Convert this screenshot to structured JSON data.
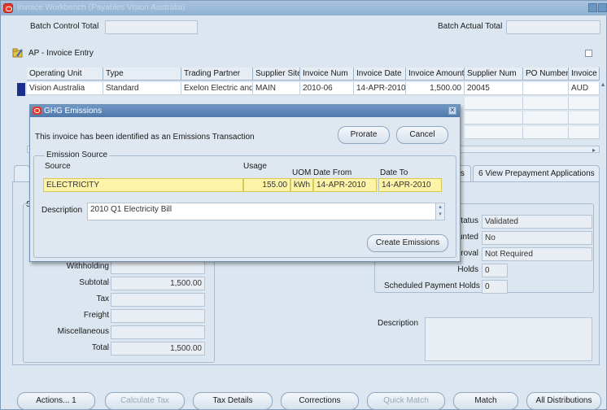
{
  "window": {
    "title": "Invoice Workbench (Payables Vision Australia)"
  },
  "batch": {
    "control_total_label": "Batch Control Total",
    "actual_total_label": "Batch Actual Total"
  },
  "section": {
    "title": "AP - Invoice Entry"
  },
  "table": {
    "headers": [
      "Operating Unit",
      "Type",
      "Trading Partner",
      "Supplier Site",
      "Invoice Num",
      "Invoice Date",
      "Invoice Amount",
      "Supplier Num",
      "PO Number",
      "Invoice"
    ],
    "row": {
      "operating_unit": "Vision Australia",
      "type": "Standard",
      "trading_partner": "Exelon Electric and",
      "supplier_site": "MAIN",
      "invoice_num": "2010-06",
      "invoice_date": "14-APR-2010",
      "invoice_amount": "1,500.00",
      "supplier_num": "20045",
      "po_number": "",
      "currency": "AUD"
    }
  },
  "tabs": {
    "partial_left": "ents",
    "view_prepayment": "6 View Prepayment Applications"
  },
  "summary": {
    "s_label": "S",
    "withholding_label": "Withholding",
    "subtotal_label": "Subtotal",
    "subtotal_value": "1,500.00",
    "tax_label": "Tax",
    "freight_label": "Freight",
    "misc_label": "Miscellaneous",
    "total_label": "Total",
    "total_value": "1,500.00"
  },
  "status": {
    "status_label": "Status",
    "status_value": "Validated",
    "accounted_label": "unted",
    "accounted_value": "No",
    "approval_label": "proval",
    "approval_value": "Not Required",
    "holds_label": "Holds",
    "holds_value": "0",
    "sched_holds_label": "Scheduled Payment Holds",
    "sched_holds_value": "0",
    "description_label": "Description"
  },
  "dialog": {
    "title": "GHG Emissions",
    "message": "This invoice has been identified as an Emissions Transaction",
    "prorate_label": "Prorate",
    "cancel_label": "Cancel",
    "group_title": "Emission Source",
    "col_source": "Source",
    "col_usage": "Usage",
    "col_uom": "UOM",
    "col_date_from": "Date From",
    "col_date_to": "Date To",
    "source_value": "ELECTRICITY",
    "usage_value": "155.00",
    "uom_value": "kWh",
    "date_from_value": "14-APR-2010",
    "date_to_value": "14-APR-2010",
    "description_label": "Description",
    "description_value": "2010 Q1 Electricity Bill",
    "create_label": "Create Emissions"
  },
  "buttons": {
    "actions": "Actions... 1",
    "calculate_tax": "Calculate Tax",
    "tax_details": "Tax Details",
    "corrections": "Corrections",
    "quick_match": "Quick Match",
    "match": "Match",
    "all_distributions": "All Distributions"
  }
}
